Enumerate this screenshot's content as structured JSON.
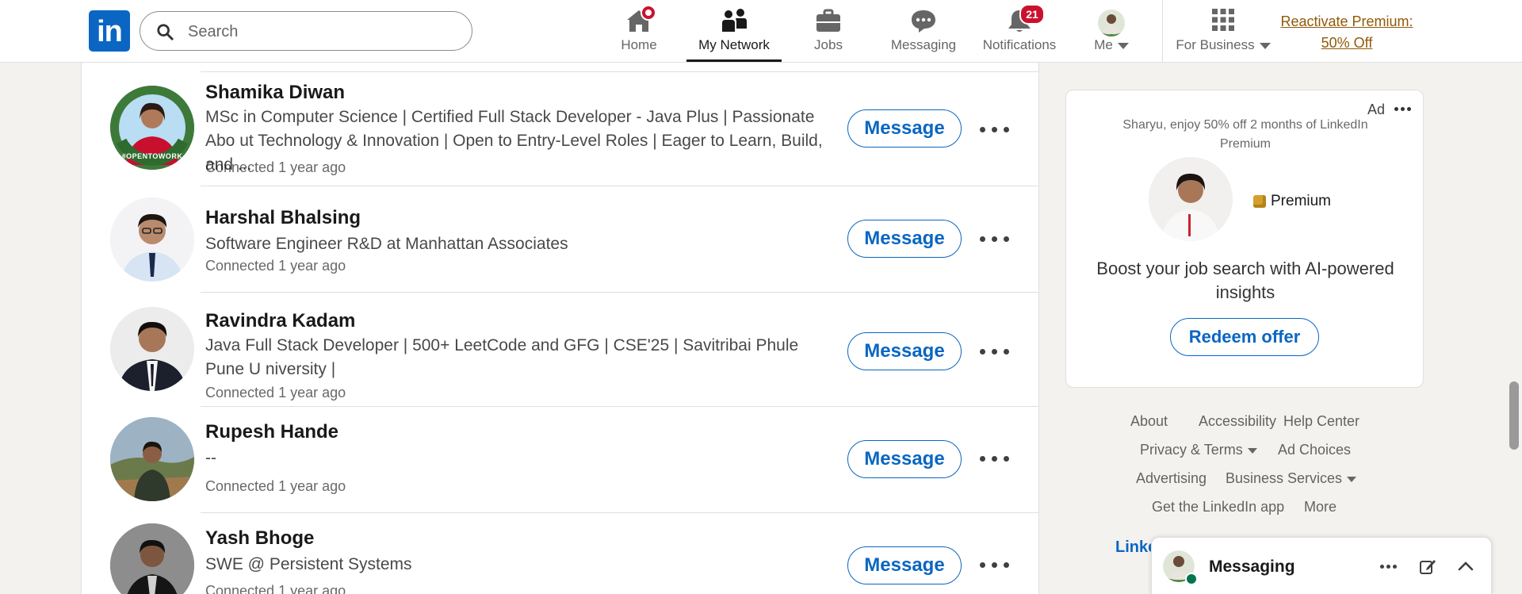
{
  "nav": {
    "logo_text": "in",
    "search_placeholder": "Search",
    "items": [
      {
        "label": "Home",
        "icon": "home-icon",
        "badge": ""
      },
      {
        "label": "My Network",
        "icon": "people-icon",
        "badge": ""
      },
      {
        "label": "Jobs",
        "icon": "briefcase-icon",
        "badge": ""
      },
      {
        "label": "Messaging",
        "icon": "chat-icon",
        "badge": ""
      },
      {
        "label": "Notifications",
        "icon": "bell-icon",
        "badge": "21"
      },
      {
        "label": "Me",
        "icon": "avatar",
        "badge": ""
      }
    ],
    "business_label": "For Business",
    "premium_line1": "Reactivate Premium:",
    "premium_line2": "50% Off",
    "active_item": "My Network"
  },
  "connections": [
    {
      "name": "Shamika Diwan",
      "headline": "MSc in Computer Science | Certified Full Stack Developer - Java Plus | Passionate Abo ut Technology & Innovation | Open to Entry-Level Roles | Eager to Learn, Build, and ...",
      "connected": "Connected 1 year ago",
      "avatar_ring_text": "#OPENTOWORK"
    },
    {
      "name": "Harshal Bhalsing",
      "headline": "Software Engineer R&D at Manhattan Associates",
      "connected": "Connected 1 year ago"
    },
    {
      "name": "Ravindra Kadam",
      "headline": "Java Full Stack Developer | 500+ LeetCode and GFG | CSE'25 | Savitribai Phule Pune U niversity |",
      "connected": "Connected 1 year ago"
    },
    {
      "name": "Rupesh Hande",
      "headline": "--",
      "connected": "Connected 1 year ago"
    },
    {
      "name": "Yash Bhoge",
      "headline": "SWE @ Persistent Systems",
      "connected": "Connected 1 year ago"
    }
  ],
  "message_button_label": "Message",
  "ad": {
    "label": "Ad",
    "offer": "Sharyu, enjoy 50% off 2 months of LinkedIn Premium",
    "premium_badge": "Premium",
    "headline": "Boost your job search with AI-powered insights",
    "cta": "Redeem offer"
  },
  "footer": {
    "about": "About",
    "accessibility": "Accessibility",
    "help": "Help Center",
    "privacy": "Privacy & Terms",
    "adchoices": "Ad Choices",
    "advertising": "Advertising",
    "business": "Business Services",
    "app": "Get the LinkedIn app",
    "more": "More",
    "brand_partial": "Linke"
  },
  "messaging_panel": {
    "title": "Messaging"
  },
  "colors": {
    "brand_blue": "#0a66c2",
    "badge_red": "#cb112d",
    "premium_gold": "#915907",
    "page_bg": "#f4f2ee"
  }
}
